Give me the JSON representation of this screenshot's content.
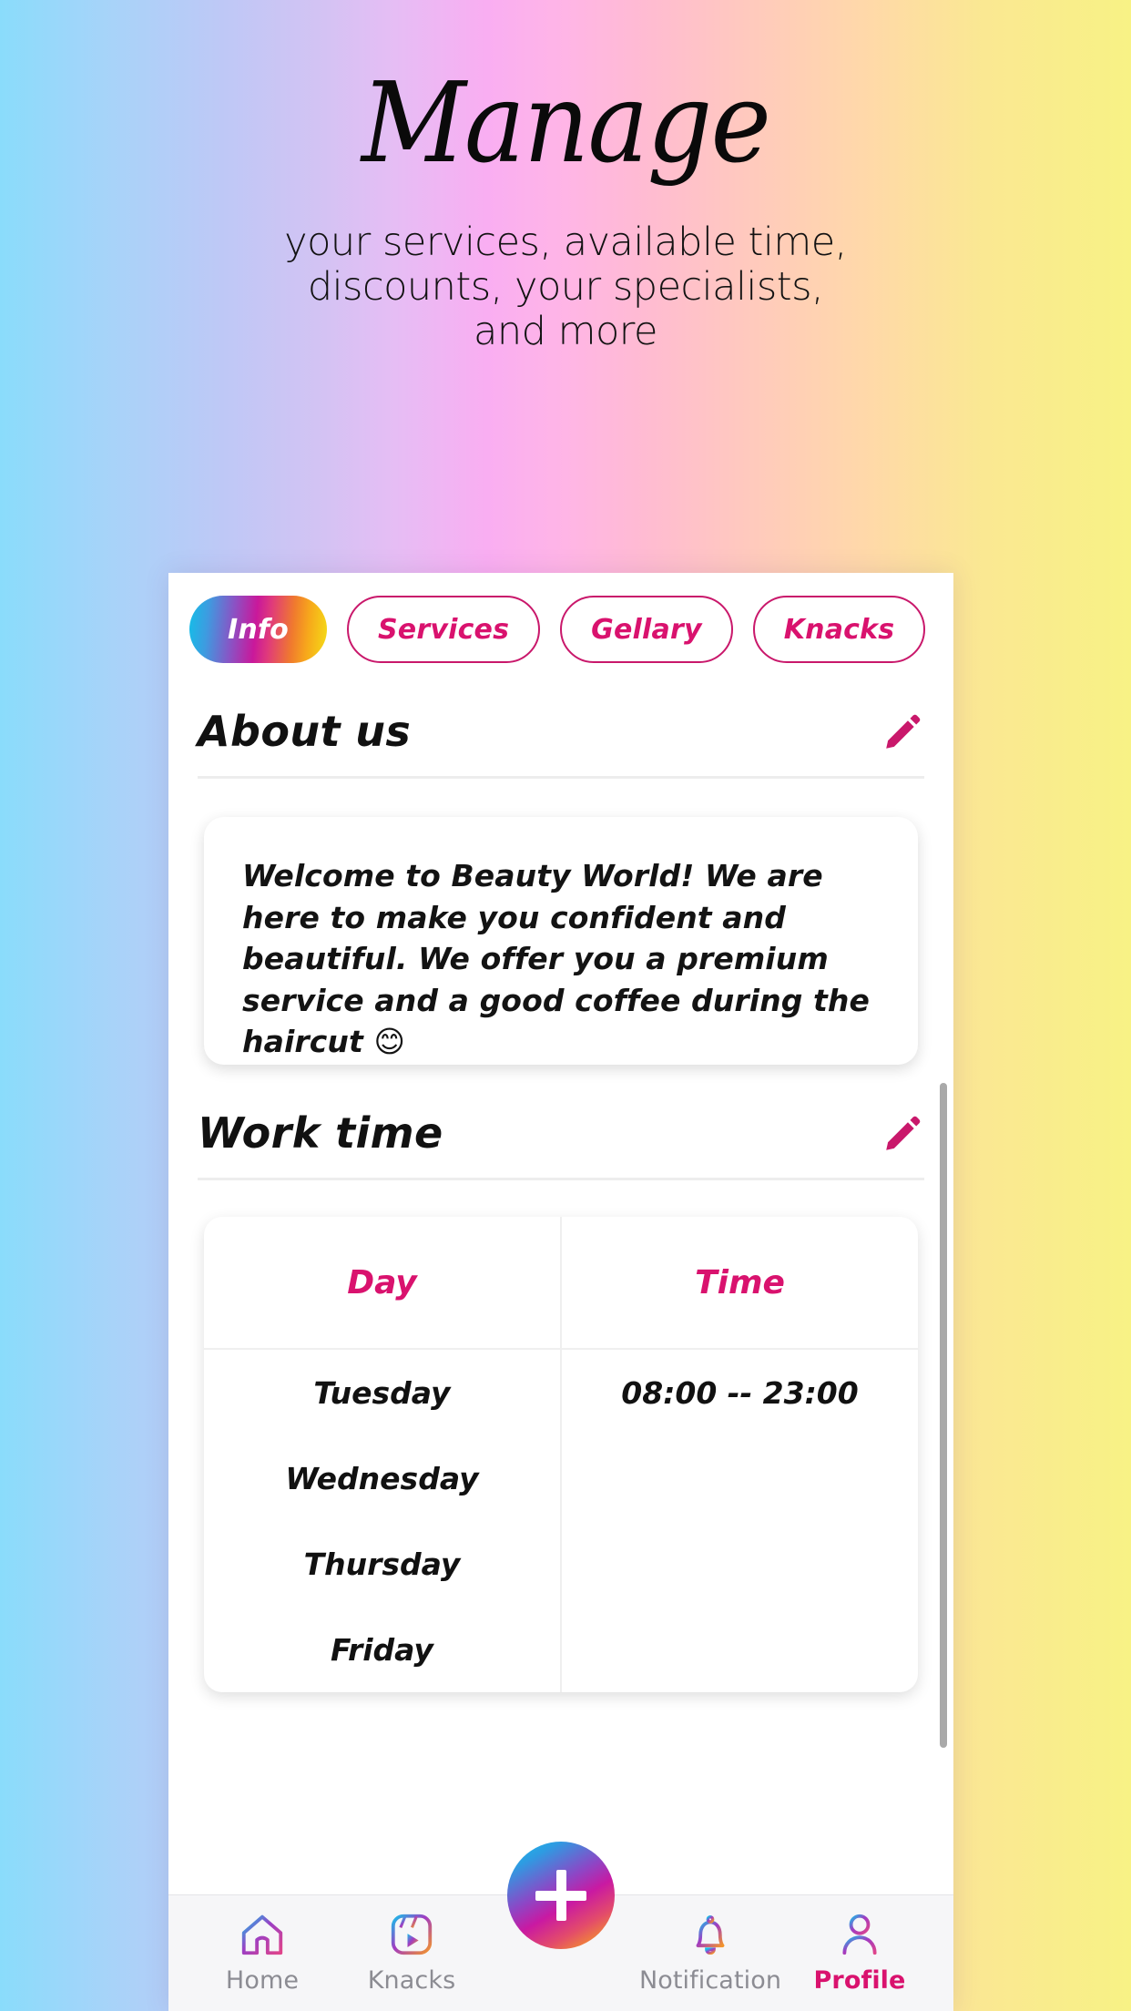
{
  "hero": {
    "title": "Manage",
    "subtitle_line1": "your services, available time,",
    "subtitle_line2": "discounts, your specialists,",
    "subtitle_line3": "and more"
  },
  "app": {
    "tabs": [
      {
        "label": "Info",
        "active": true
      },
      {
        "label": "Services",
        "active": false
      },
      {
        "label": "Gellary",
        "active": false
      },
      {
        "label": "Knacks",
        "active": false
      }
    ],
    "about": {
      "heading": "About us",
      "edit_icon": "pencil-icon",
      "text": "Welcome to Beauty World! We are here to make you confident and beautiful. We offer you a premium service and a good coffee during the haircut 😊"
    },
    "work_time": {
      "heading": "Work time",
      "edit_icon": "pencil-icon",
      "columns": [
        "Day",
        "Time"
      ],
      "rows": [
        {
          "day": "Tuesday",
          "time": "08:00 -- 23:00"
        },
        {
          "day": "Wednesday",
          "time": ""
        },
        {
          "day": "Thursday",
          "time": ""
        },
        {
          "day": "Friday",
          "time": ""
        }
      ]
    },
    "bottom_nav": {
      "items": [
        {
          "label": "Home",
          "icon": "home-icon",
          "active": false
        },
        {
          "label": "Knacks",
          "icon": "reels-icon",
          "active": false
        },
        {
          "label": "Notification",
          "icon": "bell-icon",
          "active": false
        },
        {
          "label": "Profile",
          "icon": "person-icon",
          "active": true
        }
      ],
      "fab_icon": "plus-icon"
    }
  },
  "colors": {
    "accent_pink": "#D9126E",
    "accent_border": "#C9186B",
    "nav_inactive": "#8C8C93"
  }
}
